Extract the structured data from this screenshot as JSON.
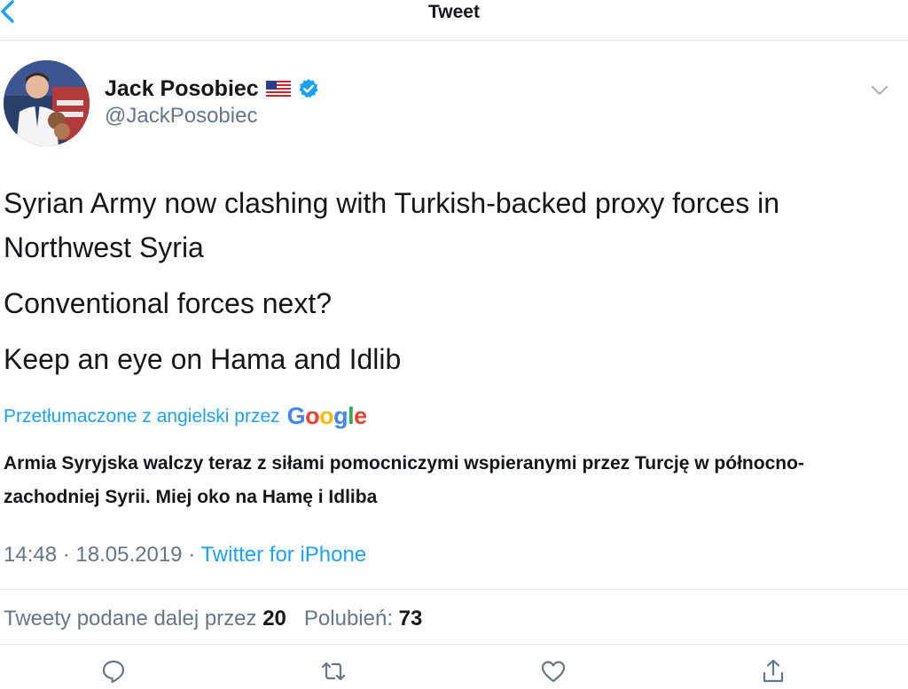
{
  "nav": {
    "title": "Tweet",
    "back_icon": "chevron-left-icon"
  },
  "author": {
    "name": "Jack Posobiec",
    "handle": "@JackPosobiec",
    "flag_icon": "us-flag-icon",
    "verified_icon": "verified-badge-icon"
  },
  "tweet": {
    "paragraphs": [
      "Syrian Army now clashing with Turkish-backed proxy forces in Northwest Syria",
      "Conventional forces next?",
      "Keep an eye on Hama and Idlib"
    ]
  },
  "translation": {
    "label": "Przetłumaczone z angielski przez",
    "provider_letters": [
      "G",
      "o",
      "o",
      "g",
      "l",
      "e"
    ],
    "text": "Armia Syryjska walczy teraz z siłami pomocniczymi wspieranymi przez Turcję w północno-zachodniej Syrii. Miej oko na Hamę i Idliba"
  },
  "meta": {
    "time": "14:48",
    "separator": "·",
    "date": "18.05.2019",
    "source": "Twitter for iPhone"
  },
  "stats": {
    "retweets_label": "Tweety podane dalej przez",
    "retweets_count": "20",
    "likes_label": "Polubień:",
    "likes_count": "73"
  },
  "actions": {
    "reply_icon": "reply-icon",
    "retweet_icon": "retweet-icon",
    "like_icon": "heart-icon",
    "share_icon": "share-icon"
  },
  "colors": {
    "accent": "#1da1f2",
    "text": "#14171a",
    "secondary": "#657786",
    "divider": "#e1e8ed"
  }
}
